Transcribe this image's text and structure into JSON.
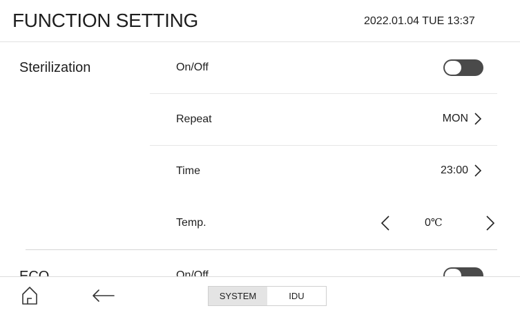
{
  "header": {
    "title": "FUNCTION SETTING",
    "datetime": "2022.01.04 TUE 13:37"
  },
  "sections": [
    {
      "name": "Sterilization",
      "rows": [
        {
          "label": "On/Off",
          "control": "toggle",
          "state": "off"
        },
        {
          "label": "Repeat",
          "control": "link",
          "value": "MON"
        },
        {
          "label": "Time",
          "control": "link",
          "value": "23:00"
        },
        {
          "label": "Temp.",
          "control": "stepper",
          "value": "0",
          "unit": "℃"
        }
      ]
    },
    {
      "name": "ECO",
      "rows": [
        {
          "label": "On/Off",
          "control": "toggle",
          "state": "off"
        }
      ]
    }
  ],
  "footer": {
    "icons": [
      "home-icon",
      "back-arrow-icon"
    ],
    "tabs": [
      {
        "label": "SYSTEM",
        "active": true
      },
      {
        "label": "IDU",
        "active": false
      }
    ]
  },
  "colors": {
    "toggle_track": "#4a4a4a",
    "active_tab": "#e4e4e4",
    "divider": "#e6e6e6"
  }
}
